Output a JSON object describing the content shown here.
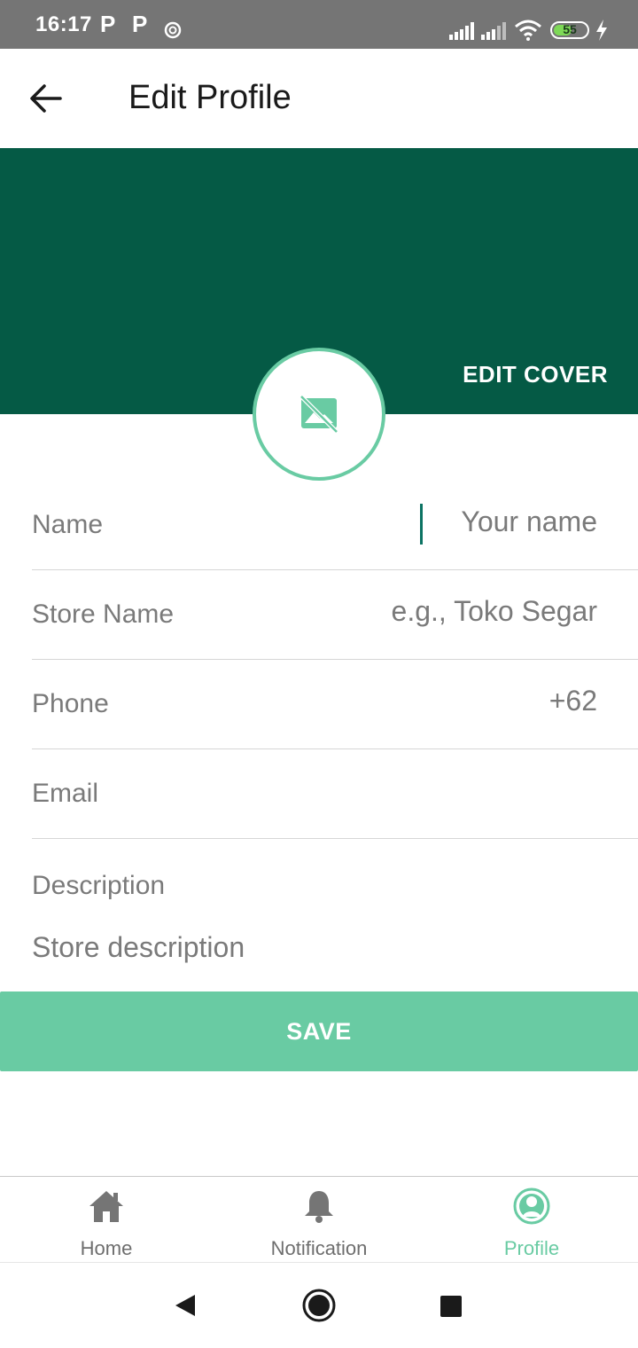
{
  "status_bar": {
    "time": "16:17",
    "notification_icons": [
      "p-icon",
      "p-icon",
      "sync-icon"
    ],
    "battery_level": "55",
    "battery_fraction": 0.55,
    "icons": [
      "signal-icon",
      "signal-icon",
      "wifi-icon",
      "battery-icon",
      "charging-icon"
    ]
  },
  "app_bar": {
    "title": "Edit Profile",
    "back_icon": "arrow-left-icon"
  },
  "cover": {
    "edit_label": "EDIT COVER",
    "color": "#055a45",
    "avatar_icon": "no-image-icon",
    "avatar_border_color": "#69cba3"
  },
  "form": {
    "fields": [
      {
        "label": "Name",
        "placeholder": "Your name"
      },
      {
        "label": "Store Name",
        "placeholder": "e.g., Toko Segar"
      },
      {
        "label": "Phone",
        "placeholder": "+62"
      },
      {
        "label": "Email",
        "placeholder": ""
      }
    ],
    "description": {
      "label": "Description",
      "placeholder": "Store description"
    },
    "save_label": "SAVE",
    "accent_color": "#69cba3"
  },
  "bottom_nav": {
    "items": [
      {
        "label": "Home",
        "icon": "home-icon",
        "active": false
      },
      {
        "label": "Notification",
        "icon": "bell-icon",
        "active": false
      },
      {
        "label": "Profile",
        "icon": "profile-icon",
        "active": true
      }
    ]
  },
  "system_nav": {
    "buttons": [
      "back-triangle-icon",
      "home-circle-icon",
      "recents-square-icon"
    ]
  }
}
